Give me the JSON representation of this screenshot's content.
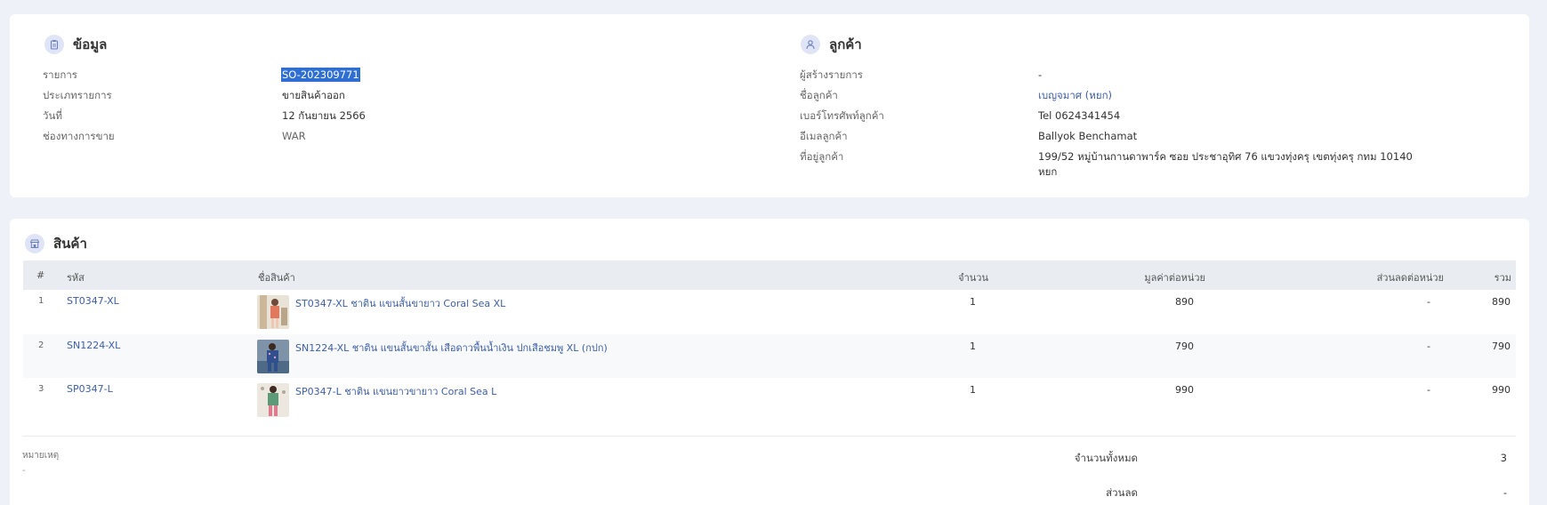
{
  "info": {
    "title": "ข้อมูล",
    "fields": [
      {
        "label": "รายการ",
        "value": "SO-202309771"
      },
      {
        "label": "ประเภทรายการ",
        "value": "ขายสินค้าออก"
      },
      {
        "label": "วันที่",
        "value": "12 กันยายน 2566"
      },
      {
        "label": "ช่องทางการขาย",
        "value": "WAR"
      }
    ]
  },
  "customer": {
    "title": "ลูกค้า",
    "fields": [
      {
        "label": "ผู้สร้างรายการ",
        "value": "-"
      },
      {
        "label": "ชื่อลูกค้า",
        "value": "เบญจมาศ (หยก)"
      },
      {
        "label": "เบอร์โทรศัพท์ลูกค้า",
        "value": "Tel 0624341454"
      },
      {
        "label": "อีเมลลูกค้า",
        "value": "Ballyok Benchamat"
      },
      {
        "label": "ที่อยู่ลูกค้า",
        "value": "199/52 หมู่บ้านกานดาพาร์ค ซอย ประชาอุทิศ 76 แขวงทุ่งครุ เขตทุ่งครุ กทม 10140",
        "value2": "หยก"
      }
    ]
  },
  "products": {
    "title": "สินค้า",
    "columns": {
      "no": "#",
      "code": "รหัส",
      "name": "ชื่อสินค้า",
      "qty": "จำนวน",
      "unit_price": "มูลค่าต่อหน่วย",
      "unit_discount": "ส่วนลดต่อหน่วย",
      "total": "รวม"
    },
    "rows": [
      {
        "no": "1",
        "code": "ST0347-XL",
        "name": "ST0347-XL ชาติน แขนสั้นขายาว Coral Sea XL",
        "qty": "1",
        "unit_price": "890",
        "unit_discount": "-",
        "total": "890"
      },
      {
        "no": "2",
        "code": "SN1224-XL",
        "name": "SN1224-XL ชาติน แขนสั้นขาสั้น เสือดาวพื้นน้ำเงิน ปกเสือชมพู XL (กปก)",
        "qty": "1",
        "unit_price": "790",
        "unit_discount": "-",
        "total": "790"
      },
      {
        "no": "3",
        "code": "SP0347-L",
        "name": "SP0347-L ชาติน แขนยาวขายาว Coral Sea L",
        "qty": "1",
        "unit_price": "990",
        "unit_discount": "-",
        "total": "990"
      }
    ]
  },
  "notes": {
    "label": "หมายเหตุ",
    "value": "-"
  },
  "summary": {
    "total_qty_label": "จำนวนทั้งหมด",
    "total_qty": "3",
    "discount_label": "ส่วนลด",
    "discount": "-"
  },
  "colors": {
    "accent": "#3d5fa5",
    "selection": "#2f6fd1",
    "background": "#eef1f8"
  }
}
